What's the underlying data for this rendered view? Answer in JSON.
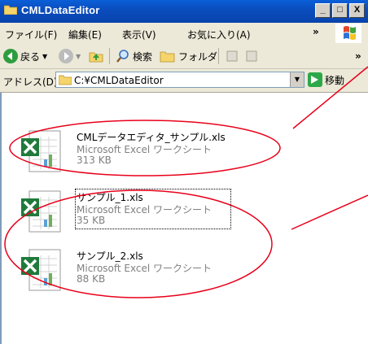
{
  "window": {
    "title": "CMLDataEditor",
    "buttons": {
      "minimize": "_",
      "maximize": "□",
      "close": "X"
    }
  },
  "menu": {
    "items": [
      "ファイル(F)",
      "編集(E)",
      "表示(V)",
      "お気に入り(A)"
    ],
    "overflow": "»"
  },
  "toolbar": {
    "back_label": "戻る",
    "search_label": "検索",
    "folders_label": "フォルダ",
    "overflow": "»"
  },
  "address": {
    "label": "アドレス(D)",
    "value": "C:¥CMLDataEditor",
    "go_label": "移動"
  },
  "files": [
    {
      "name": "CMLデータエディタ_サンプル.xls",
      "type": "Microsoft Excel ワークシート",
      "size": "313 KB"
    },
    {
      "name": "サンプル_1.xls",
      "type": "Microsoft Excel ワークシート",
      "size": "35 KB"
    },
    {
      "name": "サンプル_2.xls",
      "type": "Microsoft Excel ワークシート",
      "size": "88 KB"
    }
  ],
  "colors": {
    "title_bar": "#0a4dbe",
    "annotation": "#e8001a",
    "excel_green": "#1f7a3b"
  }
}
